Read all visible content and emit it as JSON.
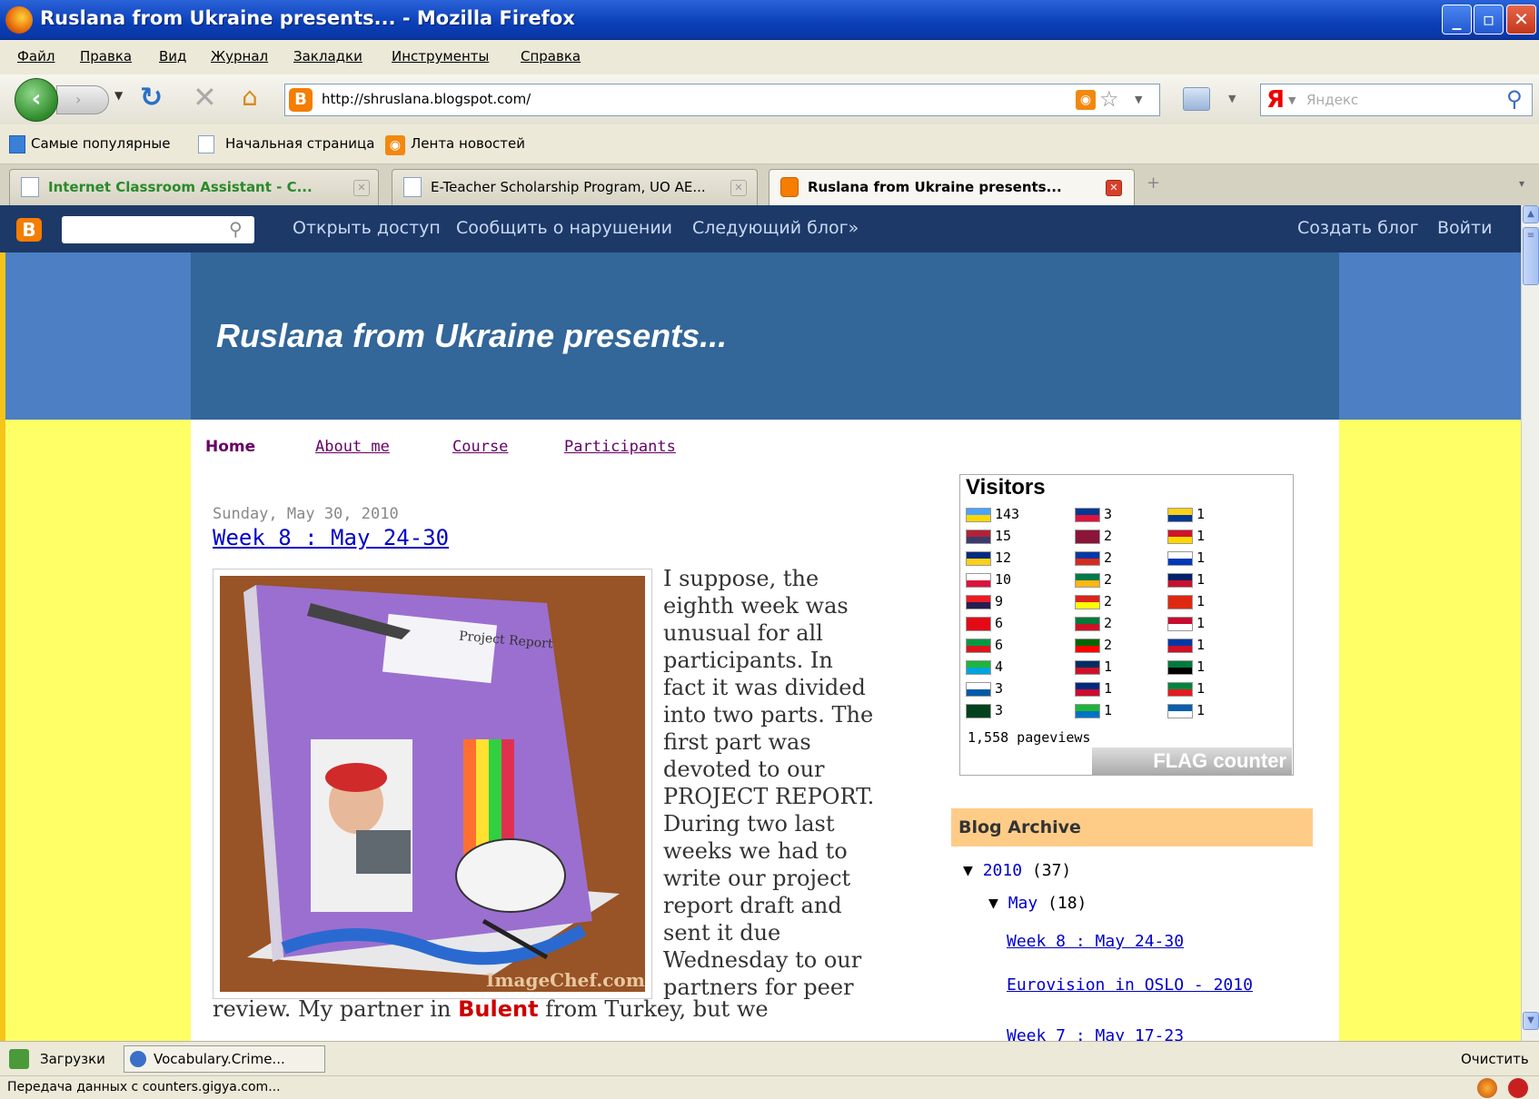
{
  "window": {
    "title": "Ruslana from Ukraine presents... - Mozilla Firefox"
  },
  "menu": [
    "Файл",
    "Правка",
    "Вид",
    "Журнал",
    "Закладки",
    "Инструменты",
    "Справка"
  ],
  "nav": {
    "url": "http://shruslana.blogspot.com/",
    "search_placeholder": "Яндекс",
    "search_engine": "Я"
  },
  "bookmarks": [
    "Самые популярные",
    "Начальная страница",
    "Лента новостей"
  ],
  "tabs": [
    {
      "label": "Internet Classroom Assistant - C...",
      "color": "#2a8a2a"
    },
    {
      "label": "E-Teacher Scholarship Program, UO AE..."
    },
    {
      "label": "Ruslana from Ukraine presents...",
      "active": true
    }
  ],
  "blogger_nav": {
    "links": [
      "Открыть доступ",
      "Сообщить о нарушении",
      "Следующий блог»"
    ],
    "right": [
      "Создать блог",
      "Войти"
    ]
  },
  "blog": {
    "title": "Ruslana from Ukraine presents...",
    "pages": [
      "Home",
      "About me",
      "Course",
      "Participants"
    ],
    "post": {
      "date": "Sunday, May 30, 2010",
      "title": "Week 8 : May 24-30",
      "image_caption": "ImageChef.com",
      "image_binder_label": "Project Report",
      "text_lines": [
        "I suppose, the",
        "eighth week was",
        "unusual for all",
        "participants. In",
        "fact it was divided",
        "into two parts. The",
        "first part was",
        "devoted to our",
        "PROJECT REPORT.",
        "During two last",
        "weeks we had to",
        "write our project",
        "report draft and",
        "sent it due",
        "Wednesday to our",
        "partners for peer"
      ],
      "last_line_start": "review. My partner in ",
      "last_line_highlight": "Bulent",
      "last_line_end": " from Turkey, but we"
    },
    "visitors": {
      "title": "Visitors",
      "columns": [
        [
          {
            "n": "143",
            "c": "#4aa3ff",
            "c2": "#ffd700"
          },
          {
            "n": "15",
            "c": "#b22234",
            "c2": "#3c3b6e"
          },
          {
            "n": "12",
            "c": "#002b7f",
            "c2": "#fcd116"
          },
          {
            "n": "10",
            "c": "#ffffff",
            "c2": "#dc143c"
          },
          {
            "n": "9",
            "c": "#ed1c24",
            "c2": "#241d4f"
          },
          {
            "n": "6",
            "c": "#e30a17",
            "c2": "#e30a17"
          },
          {
            "n": "6",
            "c": "#009a44",
            "c2": "#db161b"
          },
          {
            "n": "4",
            "c": "#1eb53a",
            "c2": "#00a3dd"
          },
          {
            "n": "3",
            "c": "#ffffff",
            "c2": "#005aa7"
          },
          {
            "n": "3",
            "c": "#01411c",
            "c2": "#01411c"
          }
        ],
        [
          {
            "n": "3",
            "c": "#003893",
            "c2": "#dc143c"
          },
          {
            "n": "2",
            "c": "#8a1538",
            "c2": "#8a1538"
          },
          {
            "n": "2",
            "c": "#0039a6",
            "c2": "#d52b1e"
          },
          {
            "n": "2",
            "c": "#007a4d",
            "c2": "#ffb612"
          },
          {
            "n": "2",
            "c": "#da251d",
            "c2": "#ffff00"
          },
          {
            "n": "2",
            "c": "#007a3d",
            "c2": "#ce1126"
          },
          {
            "n": "2",
            "c": "#006600",
            "c2": "#ff0000"
          },
          {
            "n": "1",
            "c": "#002d62",
            "c2": "#ce1126"
          },
          {
            "n": "1",
            "c": "#002b7f",
            "c2": "#cc092f"
          },
          {
            "n": "1",
            "c": "#1eb53a",
            "c2": "#0072c6"
          }
        ],
        [
          {
            "n": "1",
            "c": "#fcd116",
            "c2": "#003893"
          },
          {
            "n": "1",
            "c": "#cf142b",
            "c2": "#ffd700"
          },
          {
            "n": "1",
            "c": "#ffffff",
            "c2": "#0038b8"
          },
          {
            "n": "1",
            "c": "#012169",
            "c2": "#c8102e"
          },
          {
            "n": "1",
            "c": "#de2910",
            "c2": "#de2910"
          },
          {
            "n": "1",
            "c": "#c60c30",
            "c2": "#ffffff"
          },
          {
            "n": "1",
            "c": "#0038a8",
            "c2": "#ce1126"
          },
          {
            "n": "1",
            "c": "#007a3d",
            "c2": "#000000"
          },
          {
            "n": "1",
            "c": "#00853f",
            "c2": "#e31b23"
          },
          {
            "n": "1",
            "c": "#0d5eaf",
            "c2": "#ffffff"
          }
        ]
      ],
      "pageviews": "1,558 pageviews",
      "counter_label_flag": "FLAG",
      "counter_label_counter": "counter"
    },
    "archive": {
      "title": "Blog Archive",
      "year": "2010",
      "year_count": "(37)",
      "month": "May",
      "month_count": "(18)",
      "posts": [
        "Week 8 : May 24-30",
        "Eurovision in OSLO - 2010",
        "Week 7 : May 17-23"
      ]
    }
  },
  "downloads": {
    "label": "Загрузки",
    "item": "Vocabulary.Crime...",
    "clear": "Очистить"
  },
  "status": "Передача данных с counters.gigya.com..."
}
